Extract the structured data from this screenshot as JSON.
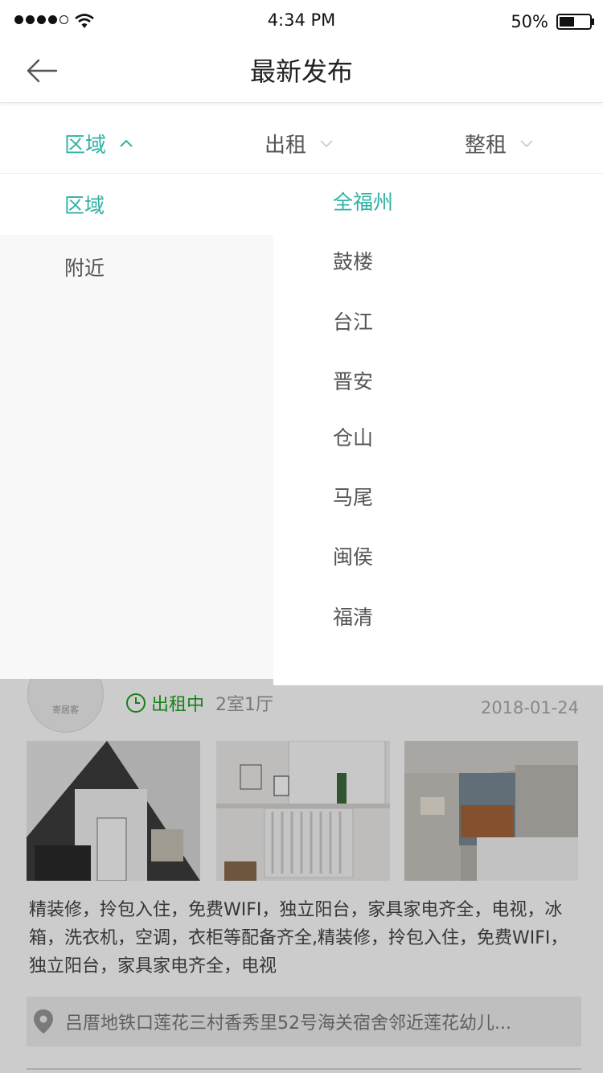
{
  "status_bar": {
    "time": "4:34 PM",
    "battery": "50%",
    "battery_level": 0.5
  },
  "nav": {
    "title": "最新发布"
  },
  "filters": [
    {
      "label": "区域",
      "active": true,
      "icon": "chevron-up-icon"
    },
    {
      "label": "出租",
      "active": false,
      "icon": "chevron-down-icon"
    },
    {
      "label": "整租",
      "active": false,
      "icon": "chevron-down-icon"
    }
  ],
  "dropdown": {
    "left_items": [
      "区域",
      "附近"
    ],
    "right_items": [
      "全福州",
      "鼓楼",
      "台江",
      "晋安",
      "仓山",
      "马尾",
      "闽侯",
      "福清"
    ]
  },
  "listing": {
    "avatar_text": "寄居客",
    "status": "出租中",
    "room_type": "2室1厅",
    "date": "2018-01-24",
    "description": "精装修，拎包入住，免费WIFI，独立阳台，家具家电齐全，电视，冰箱，洗衣机，空调，衣柜等配备齐全,精装修，拎包入住，免费WIFI，独立阳台，家具家电齐全，电视",
    "address": "吕厝地铁口莲花三村香秀里52号海关宿舍邻近莲花幼儿..."
  },
  "colors": {
    "accent": "#2fb2a4",
    "status_green": "#1ea01e"
  }
}
